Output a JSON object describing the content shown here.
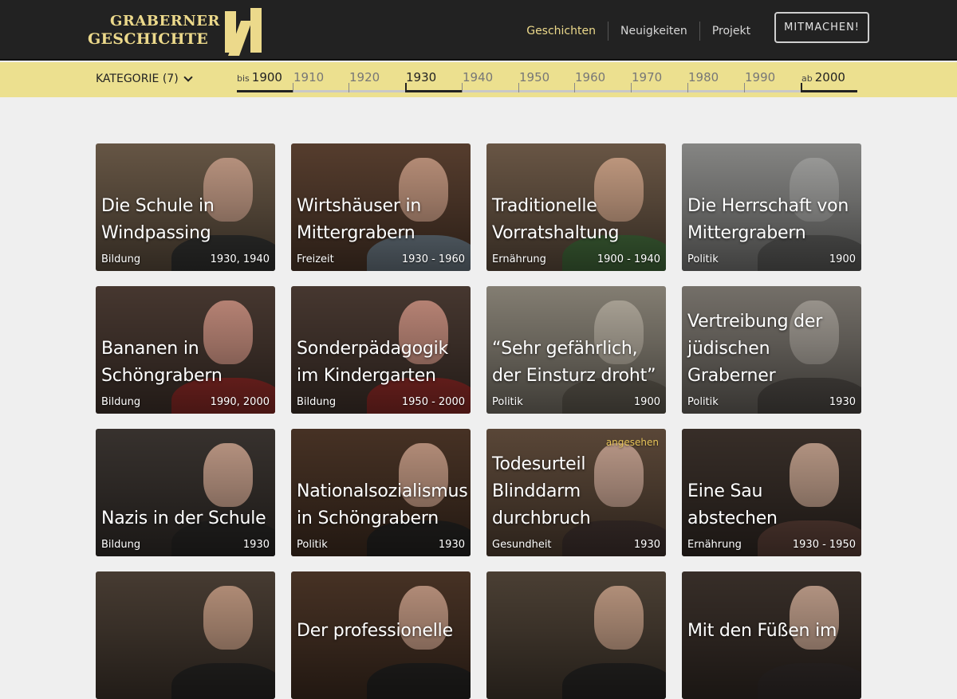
{
  "header": {
    "logo_line1": "GRABERNER",
    "logo_line2": "GESCHICHTE",
    "nav": [
      {
        "label": "Geschichten",
        "active": true
      },
      {
        "label": "Neuigkeiten",
        "active": false
      },
      {
        "label": "Projekt",
        "active": false
      }
    ],
    "cta_label": "MITMACHEN!"
  },
  "filter": {
    "category_label": "KATEGORIE (7)",
    "timeline": [
      {
        "prefix": "bis",
        "year": "1900",
        "on": true
      },
      {
        "prefix": "",
        "year": "1910",
        "on": false
      },
      {
        "prefix": "",
        "year": "1920",
        "on": false
      },
      {
        "prefix": "",
        "year": "1930",
        "on": true
      },
      {
        "prefix": "",
        "year": "1940",
        "on": false
      },
      {
        "prefix": "",
        "year": "1950",
        "on": false
      },
      {
        "prefix": "",
        "year": "1960",
        "on": false
      },
      {
        "prefix": "",
        "year": "1970",
        "on": false
      },
      {
        "prefix": "",
        "year": "1980",
        "on": false
      },
      {
        "prefix": "",
        "year": "1990",
        "on": false
      },
      {
        "prefix": "ab",
        "year": "2000",
        "on": true
      }
    ]
  },
  "stories": [
    {
      "title": "Die Schule in Windpassing",
      "category": "Bildung",
      "years": "1930, 1940",
      "badge": "",
      "bg": "#6b5a48",
      "skin": "#c9a08a",
      "cloth": "#3a3a38"
    },
    {
      "title": "Wirtshäuser in Mittergrabern",
      "category": "Freizeit",
      "years": "1930 - 1960",
      "badge": "",
      "bg": "#5a4030",
      "skin": "#c79a82",
      "cloth": "#7b8a96"
    },
    {
      "title": "Traditionelle Vorratshaltung",
      "category": "Ernährung",
      "years": "1900 - 1940",
      "badge": "",
      "bg": "#6e5a48",
      "skin": "#d1a68a",
      "cloth": "#4d7a44"
    },
    {
      "title": "Die Herrschaft von Mittergrabern",
      "category": "Politik",
      "years": "1900",
      "badge": "",
      "bg": "#8c8c8a",
      "skin": "#a8a8a6",
      "cloth": "#6a6a68"
    },
    {
      "title": "Bananen in Schöngrabern",
      "category": "Bildung",
      "years": "1990, 2000",
      "badge": "",
      "bg": "#4a3a32",
      "skin": "#c99080",
      "cloth": "#a0302c"
    },
    {
      "title": "Sonderpädagogik im Kindergarten",
      "category": "Bildung",
      "years": "1950 - 2000",
      "badge": "",
      "bg": "#4a3a32",
      "skin": "#c99080",
      "cloth": "#a0302c"
    },
    {
      "title": "“Sehr gefährlich, der Einsturz droht”",
      "category": "Politik",
      "years": "1900",
      "badge": "",
      "bg": "#8a8478",
      "skin": "#b8b0a2",
      "cloth": "#6e685c"
    },
    {
      "title": "Vertreibung der jüdischen Graberner",
      "category": "Politik",
      "years": "1930",
      "badge": "",
      "bg": "#7a756e",
      "skin": "#a8a29a",
      "cloth": "#5a5550"
    },
    {
      "title": "Nazis in der Schule",
      "category": "Bildung",
      "years": "1930",
      "badge": "",
      "bg": "#3a3430",
      "skin": "#c7a08c",
      "cloth": "#2e2c2a"
    },
    {
      "title": "Nationalsozialismus in Schöngrabern",
      "category": "Politik",
      "years": "1930",
      "badge": "",
      "bg": "#4a3426",
      "skin": "#c49a84",
      "cloth": "#2a2826"
    },
    {
      "title": "Todesurteil Blinddarm durchbruch",
      "category": "Gesundheit",
      "years": "1930",
      "badge": "angesehen",
      "bg": "#5e4a3a",
      "skin": "#c8a492",
      "cloth": "#4a3a36"
    },
    {
      "title": "Eine Sau abstechen",
      "category": "Ernährung",
      "years": "1930 - 1950",
      "badge": "",
      "bg": "#3a302a",
      "skin": "#c4a28e",
      "cloth": "#6a4a40"
    },
    {
      "title": "",
      "category": "",
      "years": "",
      "badge": "",
      "bg": "#4a3e34",
      "skin": "#c29a82",
      "cloth": "#2e2c2a"
    },
    {
      "title": "Der professionelle",
      "category": "",
      "years": "",
      "badge": "",
      "bg": "#4a3426",
      "skin": "#c49a84",
      "cloth": "#2a2826"
    },
    {
      "title": "",
      "category": "",
      "years": "",
      "badge": "",
      "bg": "#4e4236",
      "skin": "#c49e86",
      "cloth": "#2e2c2a"
    },
    {
      "title": "Mit den Füßen im",
      "category": "",
      "years": "",
      "badge": "",
      "bg": "#3a302a",
      "skin": "#c4a28e",
      "cloth": "#3a3230"
    }
  ],
  "colors": {
    "accent": "#ecd98b",
    "header_bg": "#222222",
    "page_bg": "#efefef"
  }
}
